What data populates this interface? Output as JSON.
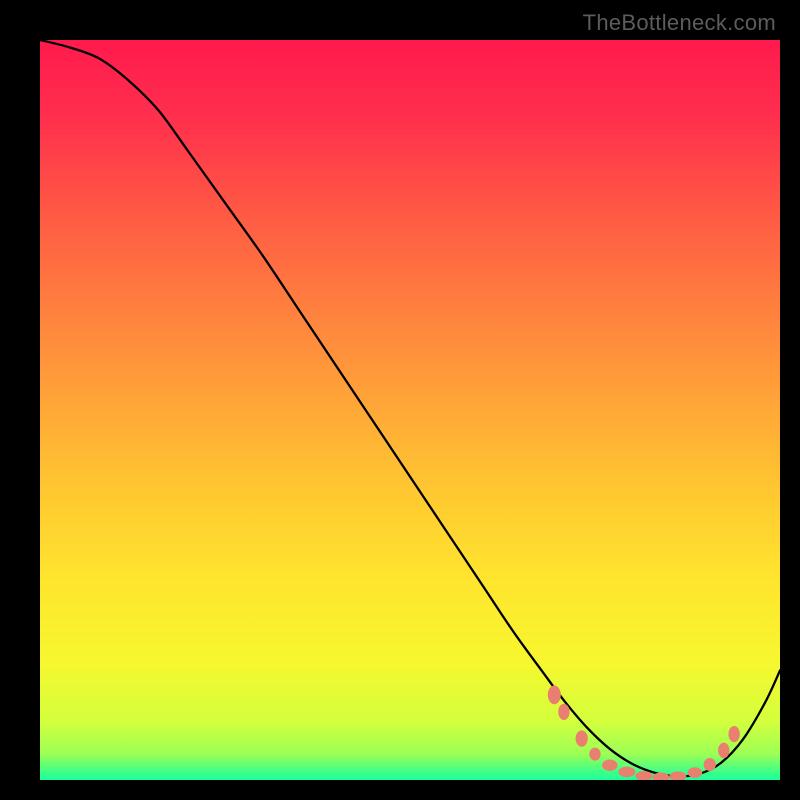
{
  "watermark": "TheBottleneck.com",
  "gradient": {
    "stops": [
      {
        "offset": 0.0,
        "color": "#ff1a4d"
      },
      {
        "offset": 0.1,
        "color": "#ff2e4d"
      },
      {
        "offset": 0.22,
        "color": "#ff5545"
      },
      {
        "offset": 0.35,
        "color": "#ff7c3f"
      },
      {
        "offset": 0.48,
        "color": "#ffa238"
      },
      {
        "offset": 0.6,
        "color": "#ffc531"
      },
      {
        "offset": 0.72,
        "color": "#ffe32e"
      },
      {
        "offset": 0.84,
        "color": "#f7f72e"
      },
      {
        "offset": 0.92,
        "color": "#d4ff3c"
      },
      {
        "offset": 0.965,
        "color": "#9cff55"
      },
      {
        "offset": 0.985,
        "color": "#4dff80"
      },
      {
        "offset": 1.0,
        "color": "#1aff9c"
      }
    ]
  },
  "chart_data": {
    "type": "line",
    "title": "",
    "xlabel": "",
    "ylabel": "",
    "xlim": [
      0,
      100
    ],
    "ylim": [
      0,
      100
    ],
    "series": [
      {
        "name": "curve",
        "x": [
          0,
          4,
          8,
          12,
          16,
          20,
          25,
          30,
          35,
          40,
          45,
          50,
          55,
          60,
          64,
          68,
          71,
          74,
          77,
          80,
          83,
          86,
          89,
          92,
          95,
          98,
          100
        ],
        "y": [
          100,
          99,
          97.5,
          94.5,
          90.5,
          85,
          78,
          71,
          63.5,
          56,
          48.5,
          41,
          33.5,
          26,
          20,
          14.5,
          10.5,
          7,
          4.2,
          2.2,
          1.0,
          0.5,
          0.8,
          2.3,
          5.5,
          10.5,
          14.8
        ]
      }
    ],
    "markers": {
      "name": "highlight-dots",
      "color": "#e9806f",
      "points": [
        {
          "x": 69.5,
          "y": 11.5,
          "rx": 1.6,
          "ry": 2.3
        },
        {
          "x": 70.8,
          "y": 9.2,
          "rx": 1.4,
          "ry": 2.0
        },
        {
          "x": 73.2,
          "y": 5.6,
          "rx": 1.5,
          "ry": 2.0
        },
        {
          "x": 75.0,
          "y": 3.5,
          "rx": 1.4,
          "ry": 1.6
        },
        {
          "x": 77.0,
          "y": 2.0,
          "rx": 1.9,
          "ry": 1.4
        },
        {
          "x": 79.3,
          "y": 1.1,
          "rx": 2.1,
          "ry": 1.3
        },
        {
          "x": 81.6,
          "y": 0.55,
          "rx": 2.1,
          "ry": 1.2
        },
        {
          "x": 83.9,
          "y": 0.35,
          "rx": 2.1,
          "ry": 1.2
        },
        {
          "x": 86.2,
          "y": 0.5,
          "rx": 2.1,
          "ry": 1.2
        },
        {
          "x": 88.5,
          "y": 1.0,
          "rx": 1.8,
          "ry": 1.3
        },
        {
          "x": 90.5,
          "y": 2.1,
          "rx": 1.5,
          "ry": 1.6
        },
        {
          "x": 92.4,
          "y": 4.0,
          "rx": 1.4,
          "ry": 1.9
        },
        {
          "x": 93.8,
          "y": 6.2,
          "rx": 1.4,
          "ry": 2.0
        }
      ]
    }
  }
}
